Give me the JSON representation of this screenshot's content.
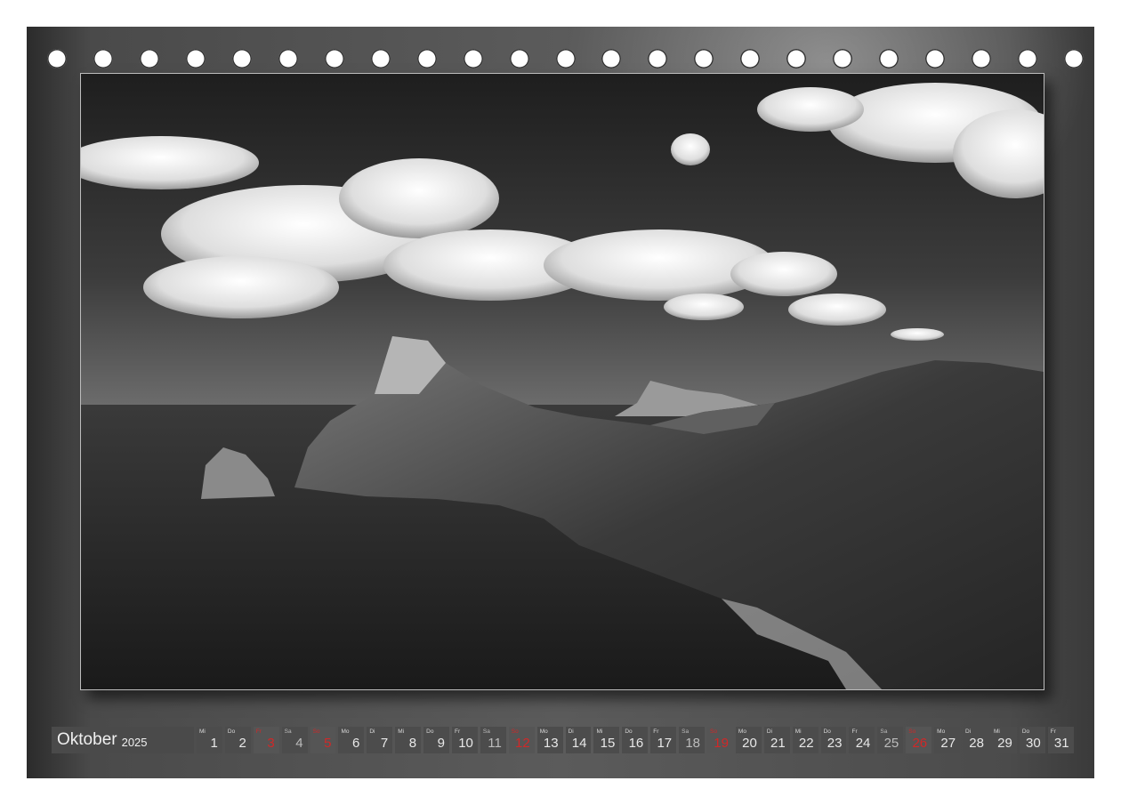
{
  "calendar": {
    "month": "Oktober",
    "year": "2025",
    "days": [
      {
        "n": "1",
        "wd": "Mi",
        "t": "work"
      },
      {
        "n": "2",
        "wd": "Do",
        "t": "work"
      },
      {
        "n": "3",
        "wd": "Fr",
        "t": "sun"
      },
      {
        "n": "4",
        "wd": "Sa",
        "t": "sat"
      },
      {
        "n": "5",
        "wd": "So",
        "t": "sun"
      },
      {
        "n": "6",
        "wd": "Mo",
        "t": "work"
      },
      {
        "n": "7",
        "wd": "Di",
        "t": "work"
      },
      {
        "n": "8",
        "wd": "Mi",
        "t": "work"
      },
      {
        "n": "9",
        "wd": "Do",
        "t": "work"
      },
      {
        "n": "10",
        "wd": "Fr",
        "t": "work"
      },
      {
        "n": "11",
        "wd": "Sa",
        "t": "sat"
      },
      {
        "n": "12",
        "wd": "So",
        "t": "sun"
      },
      {
        "n": "13",
        "wd": "Mo",
        "t": "work"
      },
      {
        "n": "14",
        "wd": "Di",
        "t": "work"
      },
      {
        "n": "15",
        "wd": "Mi",
        "t": "work"
      },
      {
        "n": "16",
        "wd": "Do",
        "t": "work"
      },
      {
        "n": "17",
        "wd": "Fr",
        "t": "work"
      },
      {
        "n": "18",
        "wd": "Sa",
        "t": "sat"
      },
      {
        "n": "19",
        "wd": "So",
        "t": "sun"
      },
      {
        "n": "20",
        "wd": "Mo",
        "t": "work"
      },
      {
        "n": "21",
        "wd": "Di",
        "t": "work"
      },
      {
        "n": "22",
        "wd": "Mi",
        "t": "work"
      },
      {
        "n": "23",
        "wd": "Do",
        "t": "work"
      },
      {
        "n": "24",
        "wd": "Fr",
        "t": "work"
      },
      {
        "n": "25",
        "wd": "Sa",
        "t": "sat"
      },
      {
        "n": "26",
        "wd": "So",
        "t": "sun"
      },
      {
        "n": "27",
        "wd": "Mo",
        "t": "work"
      },
      {
        "n": "28",
        "wd": "Di",
        "t": "work"
      },
      {
        "n": "29",
        "wd": "Mi",
        "t": "work"
      },
      {
        "n": "30",
        "wd": "Do",
        "t": "work"
      },
      {
        "n": "31",
        "wd": "Fr",
        "t": "work"
      }
    ]
  },
  "colors": {
    "sunday": "#d12828",
    "cell": "#4c4c4c",
    "board": "#5b5b5b"
  },
  "binding_holes": 23
}
